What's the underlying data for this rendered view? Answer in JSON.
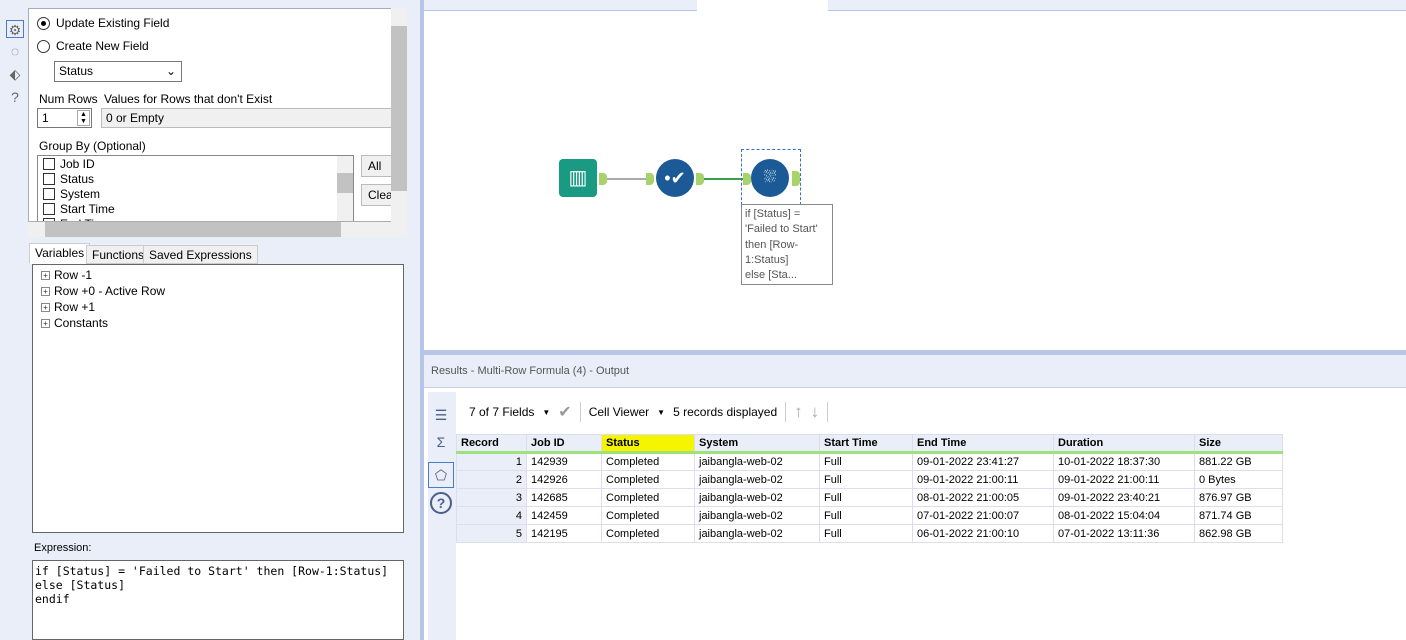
{
  "config": {
    "update_label": "Update Existing Field",
    "create_label": "Create New  Field",
    "field_select": "Status",
    "num_rows_label": "Num Rows",
    "num_rows_value": "1",
    "values_label": "Values for Rows that don't Exist",
    "values_select": "0 or Empty",
    "group_by_label": "Group By (Optional)",
    "group_by_fields": [
      "Job ID",
      "Status",
      "System",
      "Start Time",
      "End Time"
    ],
    "all_button": "All",
    "clear_button": "Clear"
  },
  "tabs": [
    "Variables",
    "Functions",
    "Saved Expressions"
  ],
  "tree": [
    "Row -1",
    "Row +0 - Active Row",
    "Row +1",
    "Constants"
  ],
  "expression_label": "Expression:",
  "expression": "if [Status] = 'Failed to Start' then [Row-1:Status]\nelse [Status]\nendif",
  "annotation": "if [Status] =\n'Failed to Start'\nthen [Row-\n1:Status]\nelse [Sta...",
  "results": {
    "title": "Results - Multi-Row Formula (4) - Output",
    "fields": "7 of 7 Fields",
    "viewer": "Cell Viewer",
    "records": "5 records displayed",
    "columns": [
      "Record",
      "Job ID",
      "Status",
      "System",
      "Start Time",
      "End Time",
      "Duration",
      "Size"
    ],
    "rows": [
      [
        "1",
        "142939",
        "Completed",
        "jaibangla-web-02",
        "Full",
        "09-01-2022 23:41:27",
        "10-01-2022 18:37:30",
        "881.22 GB"
      ],
      [
        "2",
        "142926",
        "Completed",
        "jaibangla-web-02",
        "Full",
        "09-01-2022 21:00:11",
        "09-01-2022 21:00:11",
        "0 Bytes"
      ],
      [
        "3",
        "142685",
        "Completed",
        "jaibangla-web-02",
        "Full",
        "08-01-2022 21:00:05",
        "09-01-2022 23:40:21",
        "876.97 GB"
      ],
      [
        "4",
        "142459",
        "Completed",
        "jaibangla-web-02",
        "Full",
        "07-01-2022 21:00:07",
        "08-01-2022 15:04:04",
        "871.74 GB"
      ],
      [
        "5",
        "142195",
        "Completed",
        "jaibangla-web-02",
        "Full",
        "06-01-2022 21:00:10",
        "07-01-2022 13:11:36",
        "862.98 GB"
      ]
    ],
    "highlight_color": "#f5f500"
  }
}
